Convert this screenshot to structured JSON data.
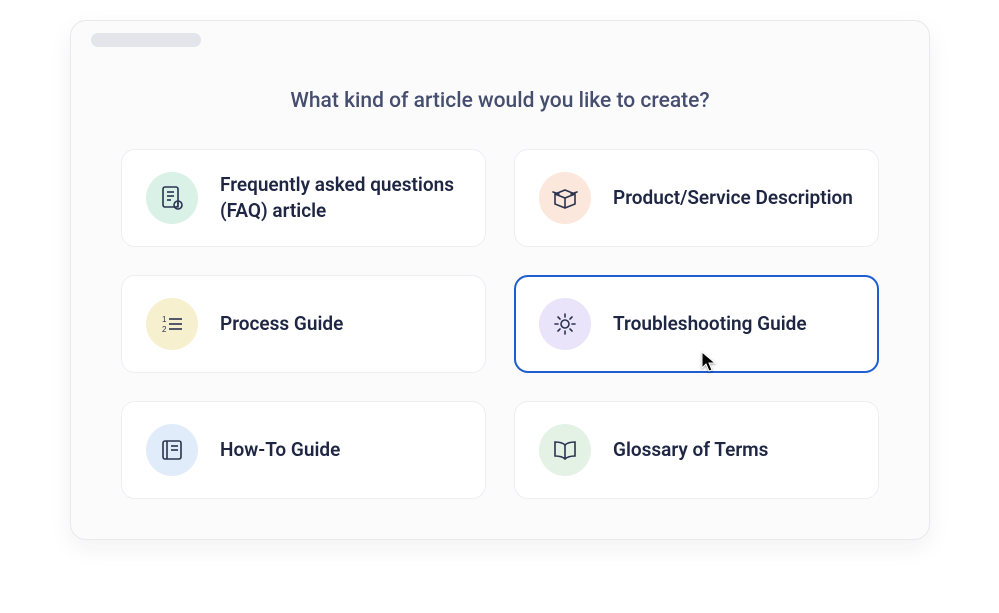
{
  "heading": "What kind of article would you like to create?",
  "options": [
    {
      "id": "faq",
      "label": "Frequently asked questions (FAQ) article",
      "icon": "document-info-icon",
      "bg": "teal",
      "selected": false
    },
    {
      "id": "product-service",
      "label": "Product/Service Description",
      "icon": "box-open-icon",
      "bg": "peach",
      "selected": false
    },
    {
      "id": "process-guide",
      "label": "Process Guide",
      "icon": "numbered-list-icon",
      "bg": "yellow",
      "selected": false
    },
    {
      "id": "troubleshooting",
      "label": "Troubleshooting Guide",
      "icon": "gear-icon",
      "bg": "lilac",
      "selected": true
    },
    {
      "id": "how-to",
      "label": "How-To Guide",
      "icon": "manual-book-icon",
      "bg": "blue",
      "selected": false
    },
    {
      "id": "glossary",
      "label": "Glossary of Terms",
      "icon": "open-book-icon",
      "bg": "green",
      "selected": false
    }
  ]
}
